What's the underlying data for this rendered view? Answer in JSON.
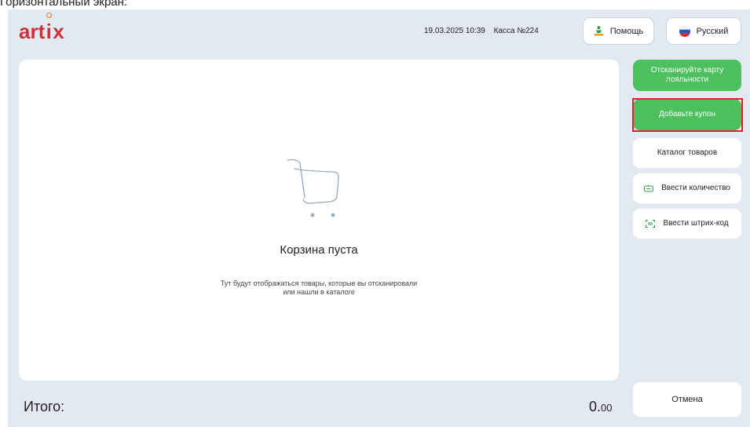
{
  "caption": "Горизонтальный экран:",
  "logo": {
    "text_start": "art",
    "text_i": "i",
    "text_end": "x"
  },
  "header": {
    "datetime": "19.03.2025 10:39",
    "register": "Касса №224",
    "help_label": "Помощь",
    "language_label": "Русский"
  },
  "cart": {
    "empty_title": "Корзина пуста",
    "empty_sub_line1": "Тут будут отображаться товары, которые вы отсканировали",
    "empty_sub_line2": "или нашли в каталоге"
  },
  "actions": {
    "loyalty_line1": "Отсканируйте карту",
    "loyalty_line2": "лояльности",
    "coupon": "Добавьте купон",
    "catalog": "Каталог товаров",
    "quantity": "Ввести количество",
    "barcode": "Ввести штрих-код"
  },
  "footer": {
    "total_label": "Итого:",
    "total_int": "0.",
    "total_cents": "00",
    "cancel": "Отмена"
  },
  "colors": {
    "accent_green": "#4cc05e",
    "highlight_red": "#e0202a",
    "brand_red": "#d0303a",
    "background": "#e3e9f1"
  },
  "icons": {
    "help": "help-person-icon",
    "language": "russia-flag-icon",
    "cart": "shopping-cart-icon",
    "quantity": "quantity-icon",
    "barcode": "barcode-scan-icon"
  }
}
